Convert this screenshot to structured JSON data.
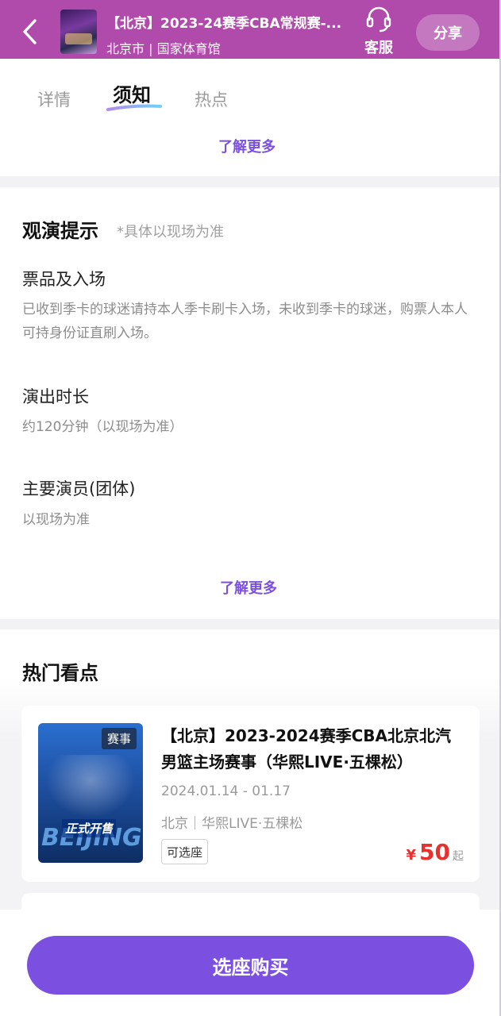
{
  "header": {
    "title": "【北京】2023-24赛季CBA常规赛-...",
    "subtitle": "北京市 | 国家体育馆",
    "service_label": "客服",
    "share_label": "分享",
    "bg_color": "#b04bab"
  },
  "tabs": [
    {
      "label": "详情",
      "active": false
    },
    {
      "label": "须知",
      "active": true
    },
    {
      "label": "热点",
      "active": false
    }
  ],
  "learn_more_1": "了解更多",
  "tips": {
    "title": "观演提示",
    "hint": "*具体以现场为准",
    "items": [
      {
        "title": "票品及入场",
        "text": "已收到季卡的球迷请持本人季卡刷卡入场，未收到季卡的球迷，购票人本人可持身份证直刷入场。"
      },
      {
        "title": "演出时长",
        "text": "约120分钟（以现场为准）"
      },
      {
        "title": "主要演员(团体)",
        "text": "以现场为准"
      }
    ],
    "learn_more": "了解更多"
  },
  "hot": {
    "title": "热门看点",
    "card": {
      "badge": "赛事",
      "poster_big_text": "BEIJING",
      "poster_sale_text": "正式开售",
      "title": "【北京】2023-2024赛季CBA北京北汽男篮主场赛事（华熙LIVE·五棵松）",
      "date": "2024.01.14 - 01.17",
      "venue": "北京｜华熙LIVE·五棵松",
      "tag": "可选座",
      "currency": "¥",
      "price": "50",
      "price_suffix": "起"
    }
  },
  "bottom": {
    "buy_label": "选座购买",
    "accent": "#7b4fe0"
  }
}
